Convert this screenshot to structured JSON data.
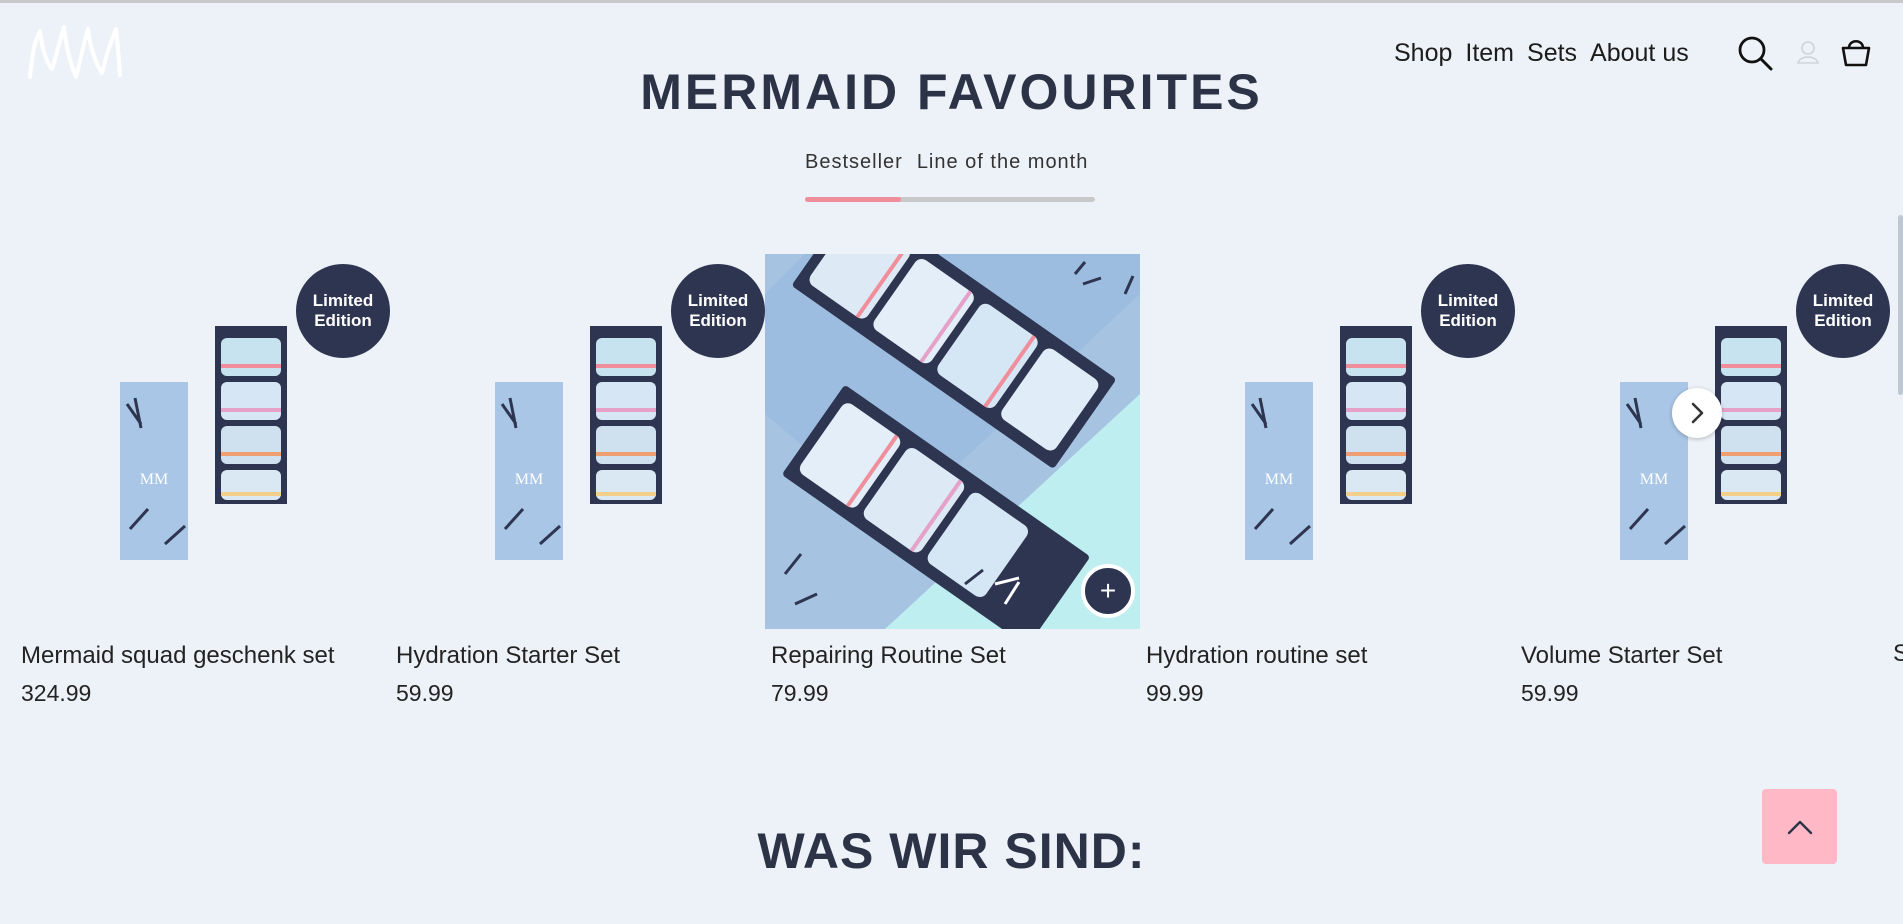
{
  "header": {
    "logo_alt": "MM",
    "nav": [
      "Shop",
      "Item",
      "Sets",
      "About us"
    ],
    "icons": [
      "search-icon",
      "user-icon",
      "basket-icon"
    ]
  },
  "section": {
    "title": "MERMAID FAVOURITES",
    "tabs": [
      "Bestseller",
      "Line of the month"
    ],
    "active_tab": 0,
    "tab_progress": 0.33
  },
  "products": [
    {
      "name": "Mermaid squad geschenk set",
      "price": "324.99",
      "badge": [
        "Limited",
        "Edition"
      ]
    },
    {
      "name": "Hydration Starter Set",
      "price": "59.99",
      "badge": [
        "Limited",
        "Edition"
      ]
    },
    {
      "name": "Repairing Routine Set",
      "price": "79.99",
      "badge": null
    },
    {
      "name": "Hydration routine set",
      "price": "99.99",
      "badge": [
        "Limited",
        "Edition"
      ]
    },
    {
      "name": "Volume Starter Set",
      "price": "59.99",
      "badge": [
        "Limited",
        "Edition"
      ]
    }
  ],
  "peek_text": "S",
  "next_section_title": "WAS WIR SIND:",
  "colors": {
    "background": "#edf2f8",
    "navy": "#2e3550",
    "accent_pink": "#f08e9c",
    "scroll_top_pink": "#ffb8c5"
  }
}
